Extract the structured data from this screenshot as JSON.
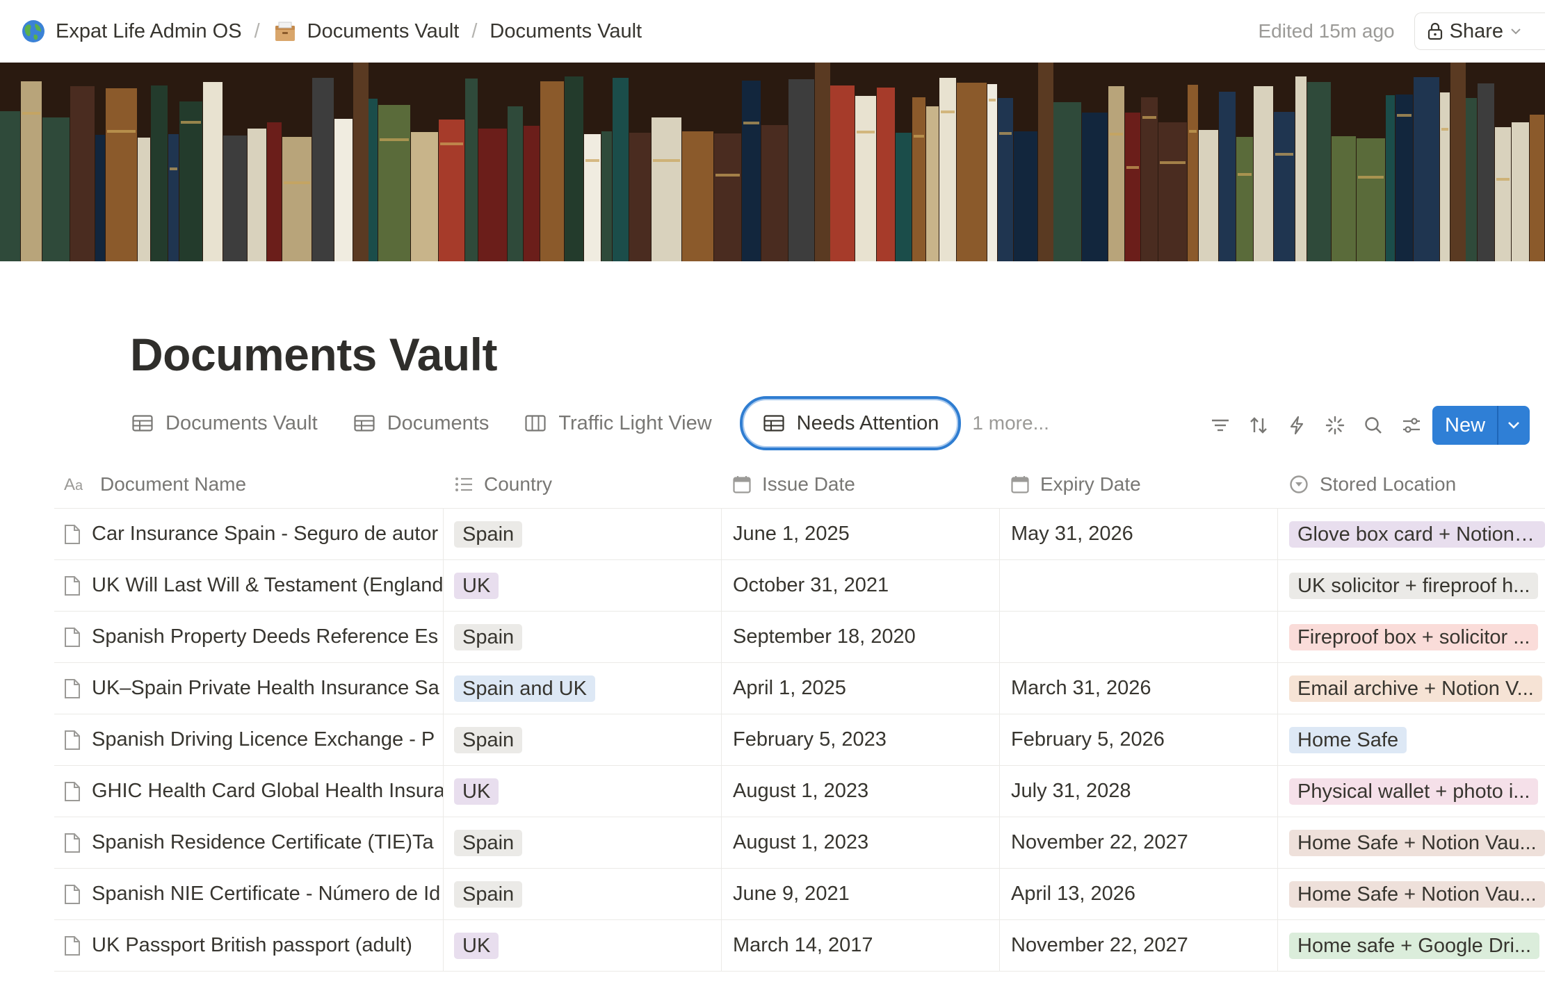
{
  "breadcrumb": {
    "workspace": "Expat Life Admin OS",
    "parent": "Documents Vault",
    "current": "Documents Vault",
    "separator": "/"
  },
  "header": {
    "edited": "Edited 15m ago",
    "share_label": "Share"
  },
  "page": {
    "title": "Documents Vault"
  },
  "views": {
    "tabs": [
      {
        "label": "Documents Vault",
        "icon": "table-icon"
      },
      {
        "label": "Documents",
        "icon": "table-icon"
      },
      {
        "label": "Traffic Light View",
        "icon": "board-icon"
      },
      {
        "label": "Needs Attention",
        "icon": "table-icon",
        "active": true
      }
    ],
    "more": "1 more..."
  },
  "toolbar": {
    "new_label": "New"
  },
  "table": {
    "columns": [
      {
        "label": "Document Name",
        "icon": "text-property-icon"
      },
      {
        "label": "Country",
        "icon": "list-property-icon"
      },
      {
        "label": "Issue Date",
        "icon": "calendar-icon"
      },
      {
        "label": "Expiry Date",
        "icon": "calendar-icon"
      },
      {
        "label": "Stored Location",
        "icon": "select-property-icon"
      }
    ],
    "rows": [
      {
        "name": "Car Insurance Spain - Seguro de autor",
        "country": "Spain",
        "issue": "June 1, 2025",
        "expiry": "May 31, 2026",
        "location": "Glove box card + Notion ...",
        "loc_color": "#e8deee",
        "country_color": "#ebeae7"
      },
      {
        "name": "UK Will Last Will & Testament (England",
        "country": "UK",
        "issue": "October 31, 2021",
        "expiry": "",
        "location": "UK solicitor + fireproof h...",
        "loc_color": "#ebeae7",
        "country_color": "#e8deee"
      },
      {
        "name": "Spanish Property Deeds Reference Es",
        "country": "Spain",
        "issue": "September 18, 2020",
        "expiry": "",
        "location": "Fireproof box + solicitor ...",
        "loc_color": "#fadcd9",
        "country_color": "#ebeae7"
      },
      {
        "name": "UK–Spain Private Health Insurance Sa",
        "country": "Spain and UK",
        "issue": "April 1, 2025",
        "expiry": "March 31, 2026",
        "location": "Email archive + Notion V...",
        "loc_color": "#f6e3d5",
        "country_color": "#dde8f5"
      },
      {
        "name": "Spanish Driving Licence Exchange - P",
        "country": "Spain",
        "issue": "February 5, 2023",
        "expiry": "February 5, 2026",
        "location": "Home Safe",
        "loc_color": "#dde8f5",
        "country_color": "#ebeae7"
      },
      {
        "name": "GHIC Health Card Global Health Insura",
        "country": "UK",
        "issue": "August 1, 2023",
        "expiry": "July 31, 2028",
        "location": "Physical wallet + photo i...",
        "loc_color": "#f5e0e9",
        "country_color": "#e8deee"
      },
      {
        "name": "Spanish Residence Certificate (TIE)Ta",
        "country": "Spain",
        "issue": "August 1, 2023",
        "expiry": "November 22, 2027",
        "location": "Home Safe + Notion Vau...",
        "loc_color": "#eee0da",
        "country_color": "#ebeae7"
      },
      {
        "name": "Spanish NIE Certificate - Número de Id",
        "country": "Spain",
        "issue": "June 9, 2021",
        "expiry": "April 13, 2026",
        "location": "Home Safe + Notion Vau...",
        "loc_color": "#eee0da",
        "country_color": "#ebeae7"
      },
      {
        "name": "UK Passport British passport (adult)",
        "country": "UK",
        "issue": "March 14, 2017",
        "expiry": "November 22, 2027",
        "location": "Home safe + Google Dri...",
        "loc_color": "#dbeddb",
        "country_color": "#e8deee"
      }
    ]
  }
}
